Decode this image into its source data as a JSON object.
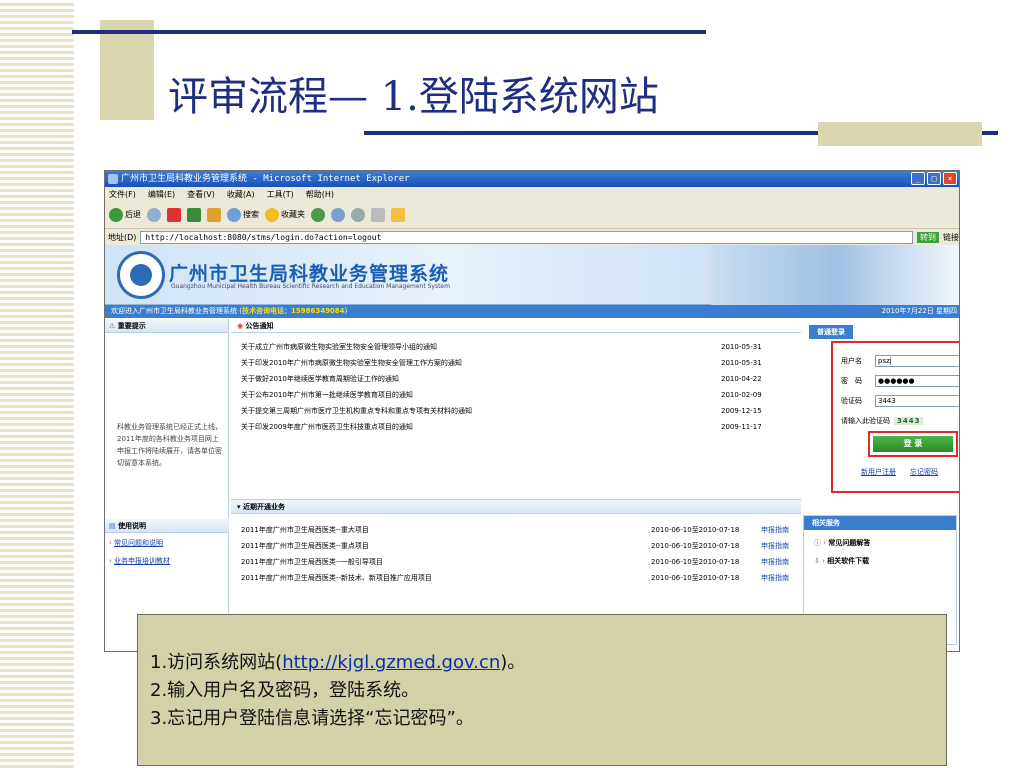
{
  "slide": {
    "title": "评审流程— 1.登陆系统网站"
  },
  "window": {
    "title": "广州市卫生局科教业务管理系统 - Microsoft Internet Explorer",
    "min": "_",
    "max": "□",
    "close": "×"
  },
  "menu": [
    "文件(F)",
    "编辑(E)",
    "查看(V)",
    "收藏(A)",
    "工具(T)",
    "帮助(H)"
  ],
  "toolbar": {
    "back": "后退",
    "search": "搜索",
    "favorites": "收藏夹"
  },
  "address": {
    "label": "地址(D)",
    "url": "http://localhost:8080/stms/login.do?action=logout",
    "go": "转到",
    "links": "链接"
  },
  "site": {
    "title": "广州市卫生局科教业务管理系统",
    "subtitle": "Guangzhou Municipal Health Bureau Scientific Research and Education Management System",
    "welcome": "欢迎进入广州市卫生局科教业务管理系统 (",
    "hotline": "技术咨询电话：15986349084",
    "welcome_end": ")",
    "date": "2010年7月22日 星期四"
  },
  "left": {
    "important_title": "重要提示",
    "notice": "科教业务管理系统已经正式上线，2011年度的各科教业务项目网上申报工作将陆续展开，请各单位密切留意本系统。",
    "usage_title": "使用说明",
    "links": [
      "常见问题和说明",
      "业务申报培训教材"
    ]
  },
  "announcements": {
    "title": "公告通知",
    "items": [
      {
        "text": "关于成立广州市病原微生物实验室生物安全管理领导小组的通知",
        "date": "2010-05-31"
      },
      {
        "text": "关于印发2010年广州市病原微生物实验室生物安全管理工作方案的通知",
        "date": "2010-05-31"
      },
      {
        "text": "关于做好2010年继续医学教育周期验证工作的通知",
        "date": "2010-04-22"
      },
      {
        "text": "关于公布2010年广州市第一批继续医学教育项目的通知",
        "date": "2010-02-09"
      },
      {
        "text": "关于提交第三周期广州市医疗卫生机构重点专科和重点专项有关材料的通知",
        "date": "2009-12-15"
      },
      {
        "text": "关于印发2009年度广州市医药卫生科技重点项目的通知",
        "date": "2009-11-17"
      }
    ]
  },
  "projects": {
    "title": "近期开通业务",
    "guide": "申报指南",
    "items": [
      {
        "text": "2011年度广州市卫生局西医类--重大项目",
        "date": "2010-06-10至2010-07-18"
      },
      {
        "text": "2011年度广州市卫生局西医类--重点项目",
        "date": "2010-06-10至2010-07-18"
      },
      {
        "text": "2011年度广州市卫生局西医类--一般引导项目",
        "date": "2010-06-10至2010-07-18"
      },
      {
        "text": "2011年度广州市卫生局西医类--新技术、新项目推广应用项目",
        "date": "2010-06-10至2010-07-18"
      }
    ]
  },
  "login": {
    "title": "普通登录",
    "user_label": "用户名",
    "user_value": "pszj",
    "pass_label": "密　码",
    "pass_value": "●●●●●●",
    "code_label": "验证码",
    "code_value": "3443",
    "code_hint": "请输入此验证码",
    "captcha": "3443",
    "submit": "登 录",
    "register": "新用户注册",
    "forgot": "忘记密码"
  },
  "services": {
    "title": "相关服务",
    "items": [
      "常见问题解答",
      "相关软件下载"
    ]
  },
  "caption": {
    "l1a": "1.访问系统网站(",
    "url": "http://kjgl.gzmed.gov.cn",
    "l1b": ")。",
    "l2": "2.输入用户名及密码，登陆系统。",
    "l3": "3.忘记用户登陆信息请选择“忘记密码”。"
  }
}
